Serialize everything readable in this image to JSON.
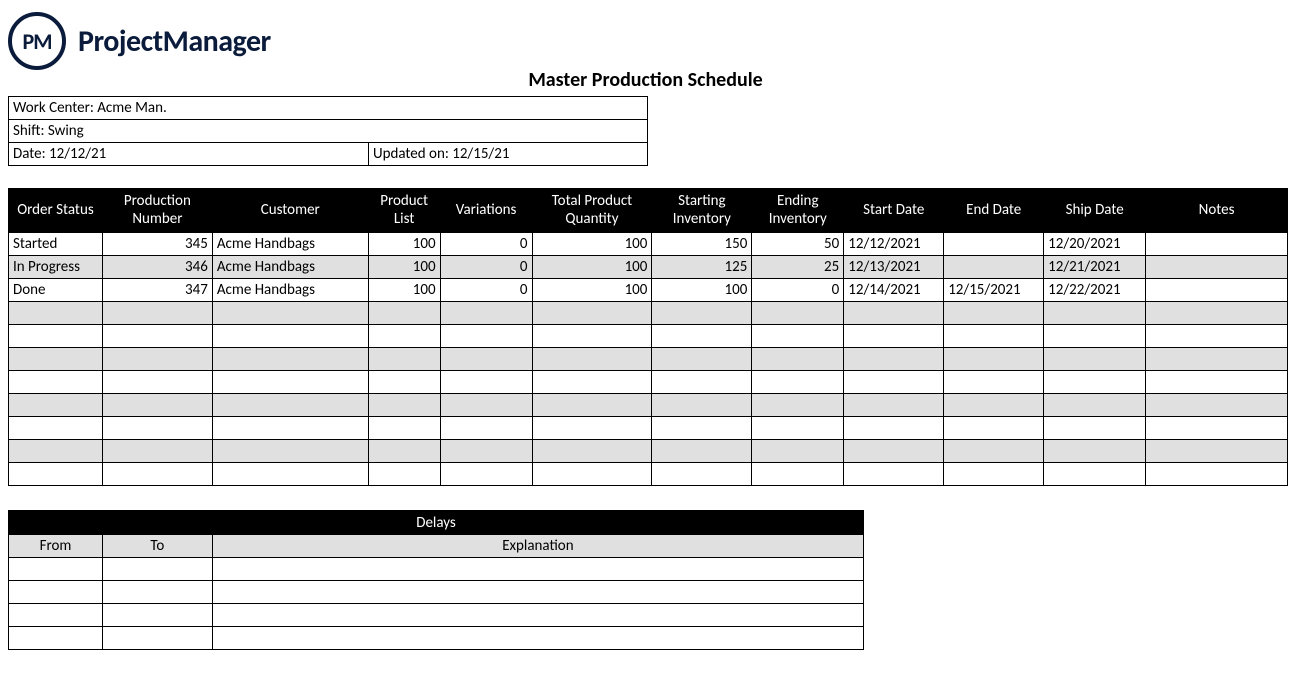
{
  "brand": {
    "initials": "PM",
    "name": "ProjectManager"
  },
  "title": "Master Production Schedule",
  "meta": {
    "work_center_label": "Work Center: Acme Man.",
    "shift_label": "Shift: Swing",
    "date_label": "Date: 12/12/21",
    "updated_label": "Updated on: 12/15/21"
  },
  "columns": {
    "order_status": "Order Status",
    "production_number": "Production Number",
    "customer": "Customer",
    "product_list": "Product List",
    "variations": "Variations",
    "total_qty": "Total Product Quantity",
    "start_inv": "Starting Inventory",
    "end_inv": "Ending Inventory",
    "start_date": "Start Date",
    "end_date": "End Date",
    "ship_date": "Ship Date",
    "notes": "Notes"
  },
  "rows": [
    {
      "status": "Started",
      "prodnum": "345",
      "customer": "Acme Handbags",
      "plist": "100",
      "var": "0",
      "totqty": "100",
      "sinv": "150",
      "einv": "50",
      "sdate": "12/12/2021",
      "edate": "",
      "shipdate": "12/20/2021",
      "notes": ""
    },
    {
      "status": "In Progress",
      "prodnum": "346",
      "customer": "Acme Handbags",
      "plist": "100",
      "var": "0",
      "totqty": "100",
      "sinv": "125",
      "einv": "25",
      "sdate": "12/13/2021",
      "edate": "",
      "shipdate": "12/21/2021",
      "notes": ""
    },
    {
      "status": "Done",
      "prodnum": "347",
      "customer": "Acme Handbags",
      "plist": "100",
      "var": "0",
      "totqty": "100",
      "sinv": "100",
      "einv": "0",
      "sdate": "12/14/2021",
      "edate": "12/15/2021",
      "shipdate": "12/22/2021",
      "notes": ""
    },
    {
      "status": "",
      "prodnum": "",
      "customer": "",
      "plist": "",
      "var": "",
      "totqty": "",
      "sinv": "",
      "einv": "",
      "sdate": "",
      "edate": "",
      "shipdate": "",
      "notes": ""
    },
    {
      "status": "",
      "prodnum": "",
      "customer": "",
      "plist": "",
      "var": "",
      "totqty": "",
      "sinv": "",
      "einv": "",
      "sdate": "",
      "edate": "",
      "shipdate": "",
      "notes": ""
    },
    {
      "status": "",
      "prodnum": "",
      "customer": "",
      "plist": "",
      "var": "",
      "totqty": "",
      "sinv": "",
      "einv": "",
      "sdate": "",
      "edate": "",
      "shipdate": "",
      "notes": ""
    },
    {
      "status": "",
      "prodnum": "",
      "customer": "",
      "plist": "",
      "var": "",
      "totqty": "",
      "sinv": "",
      "einv": "",
      "sdate": "",
      "edate": "",
      "shipdate": "",
      "notes": ""
    },
    {
      "status": "",
      "prodnum": "",
      "customer": "",
      "plist": "",
      "var": "",
      "totqty": "",
      "sinv": "",
      "einv": "",
      "sdate": "",
      "edate": "",
      "shipdate": "",
      "notes": ""
    },
    {
      "status": "",
      "prodnum": "",
      "customer": "",
      "plist": "",
      "var": "",
      "totqty": "",
      "sinv": "",
      "einv": "",
      "sdate": "",
      "edate": "",
      "shipdate": "",
      "notes": ""
    },
    {
      "status": "",
      "prodnum": "",
      "customer": "",
      "plist": "",
      "var": "",
      "totqty": "",
      "sinv": "",
      "einv": "",
      "sdate": "",
      "edate": "",
      "shipdate": "",
      "notes": ""
    },
    {
      "status": "",
      "prodnum": "",
      "customer": "",
      "plist": "",
      "var": "",
      "totqty": "",
      "sinv": "",
      "einv": "",
      "sdate": "",
      "edate": "",
      "shipdate": "",
      "notes": ""
    }
  ],
  "delays": {
    "title": "Delays",
    "headers": {
      "from": "From",
      "to": "To",
      "explanation": "Explanation"
    },
    "rows": [
      {
        "from": "",
        "to": "",
        "explanation": ""
      },
      {
        "from": "",
        "to": "",
        "explanation": ""
      },
      {
        "from": "",
        "to": "",
        "explanation": ""
      },
      {
        "from": "",
        "to": "",
        "explanation": ""
      }
    ]
  }
}
